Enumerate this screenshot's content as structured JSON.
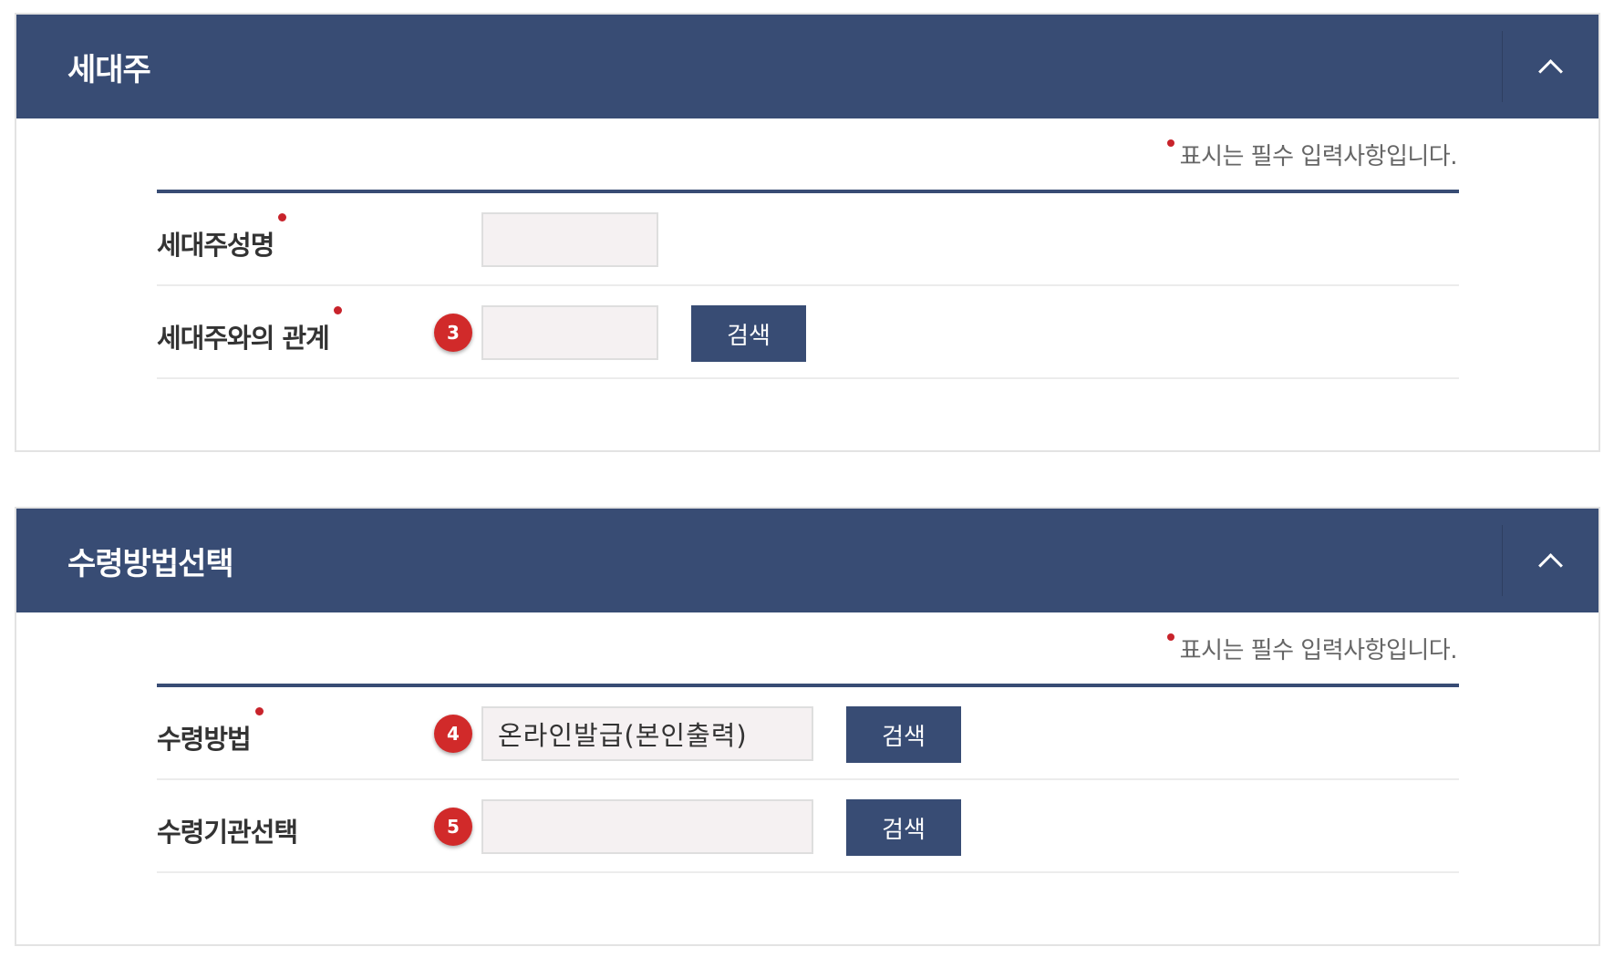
{
  "required_note": "표시는 필수 입력사항입니다.",
  "search_label": "검색",
  "householder": {
    "title": "세대주",
    "fields": {
      "name": {
        "label": "세대주성명",
        "value": ""
      },
      "relation": {
        "label": "세대주와의 관계",
        "badge": "3",
        "value": ""
      }
    }
  },
  "receipt": {
    "title": "수령방법선택",
    "fields": {
      "method": {
        "label": "수령방법",
        "badge": "4",
        "value": "온라인발급(본인출력)"
      },
      "agency": {
        "label": "수령기관선택",
        "badge": "5",
        "value": ""
      }
    }
  }
}
